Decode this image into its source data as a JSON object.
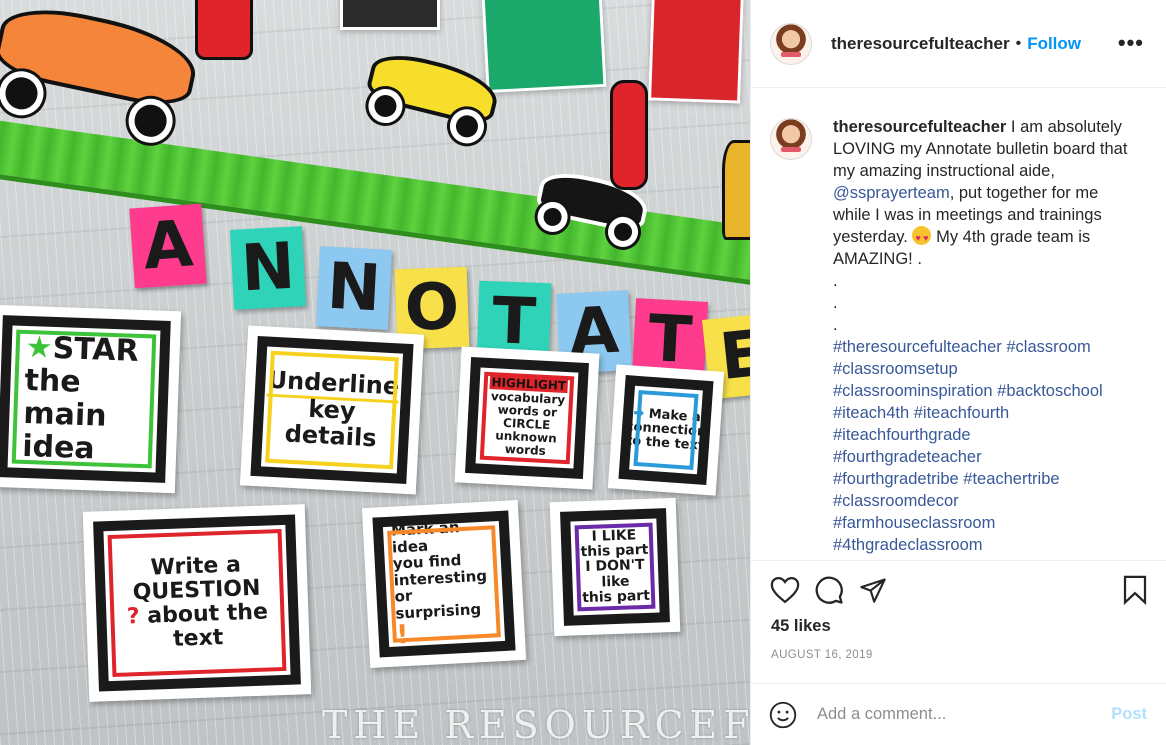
{
  "photo": {
    "letters": [
      "A",
      "N",
      "N",
      "O",
      "T",
      "A",
      "T",
      "E"
    ],
    "letter_colors": [
      "#ff3b8d",
      "#2ed3b8",
      "#8cc8f0",
      "#f7e04a",
      "#2ed3b8",
      "#8cc8f0",
      "#ff3b8d",
      "#f7e04a"
    ],
    "cards": {
      "star": [
        "STAR",
        "the main",
        "idea"
      ],
      "underline": [
        "Underline",
        "key",
        "details"
      ],
      "highlight": [
        "HIGHLIGHT",
        "vocabulary",
        "words or",
        "CIRCLE unknown",
        "words"
      ],
      "connection": [
        "Make a",
        "connection",
        "to the text"
      ],
      "question": [
        "Write a",
        "QUESTION",
        "about the",
        "text"
      ],
      "mark": [
        "Mark an idea",
        "you find",
        "interesting",
        "or surprising"
      ],
      "like": [
        "I LIKE",
        "this part",
        "I DON'T like",
        "this part"
      ]
    },
    "watermark": "THE RESOURCEFUL TEACHER"
  },
  "header": {
    "username": "theresourcefulteacher",
    "separator": "•",
    "follow_label": "Follow",
    "more_label": "•••"
  },
  "caption": {
    "username": "theresourcefulteacher",
    "text_before_mention": " I am absolutely LOVING my Annotate bulletin board that my amazing instructional aide, ",
    "mention": "@ssprayerteam",
    "text_after_mention": ", put together for me while I was in meetings and trainings yesterday. ",
    "text_after_emoji": " My 4th grade team is AMAZING! .",
    "dots": [
      ".",
      ".",
      "."
    ],
    "hashtags": [
      "#theresourcefulteacher",
      "#classroom",
      "#classroomsetup",
      "#classroominspiration",
      "#backtoschool",
      "#iteach4th",
      "#iteachfourth",
      "#iteachfourthgrade",
      "#fourthgradeteacher",
      "#fourthgradetribe",
      "#teachertribe",
      "#classroomdecor",
      "#farmhouseclassroom",
      "#4thgradeclassroom"
    ]
  },
  "actions": {
    "like_icon": "heart-icon",
    "comment_icon": "comment-icon",
    "share_icon": "send-icon",
    "save_icon": "bookmark-icon"
  },
  "likes_label": "45 likes",
  "date_label": "AUGUST 16, 2019",
  "comment_box": {
    "placeholder": "Add a comment...",
    "post_label": "Post"
  }
}
